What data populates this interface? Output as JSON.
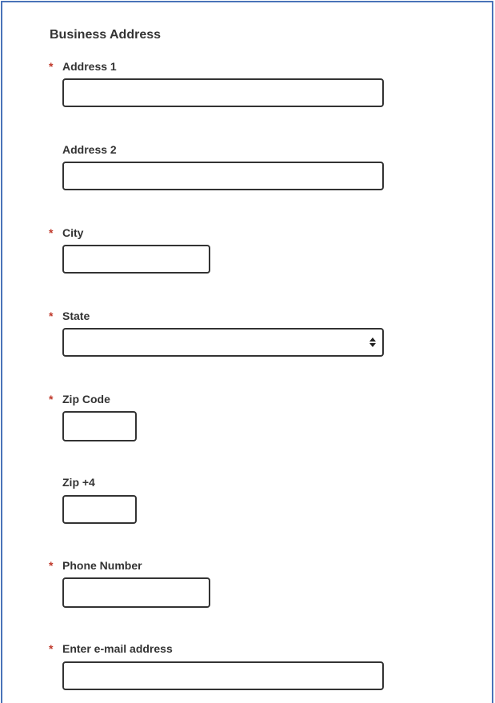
{
  "section": {
    "title": "Business Address"
  },
  "fields": {
    "address1": {
      "label": "Address 1",
      "required": "*",
      "value": ""
    },
    "address2": {
      "label": "Address 2",
      "value": ""
    },
    "city": {
      "label": "City",
      "required": "*",
      "value": ""
    },
    "state": {
      "label": "State",
      "required": "*",
      "selected": ""
    },
    "zip": {
      "label": "Zip Code",
      "required": "*",
      "value": ""
    },
    "zip4": {
      "label": "Zip +4",
      "value": ""
    },
    "phone": {
      "label": "Phone Number",
      "required": "*",
      "value": ""
    },
    "email": {
      "label": "Enter e-mail address",
      "required": "*",
      "value": ""
    }
  },
  "colors": {
    "frame": "#4a73b8",
    "required_marker": "#c0392b",
    "text": "#333333"
  },
  "icons": {
    "select_arrow": "up-down-caret-icon"
  }
}
